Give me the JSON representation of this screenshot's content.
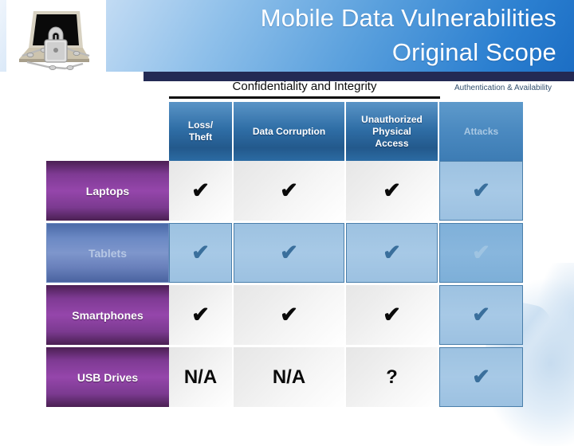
{
  "slide": {
    "title_line1": "Mobile Data Vulnerabilities",
    "title_line2": "Original Scope",
    "title": "Mobile Data Vulnerabilities\nOriginal Scope",
    "logo_icon": "laptop-padlock-chain-image",
    "accent_banner": "#2b7fd0",
    "navy_bar": "#232a54",
    "row_label_purple": "#9546ab",
    "selected_row_blue": "#7e96cc"
  },
  "captions": {
    "confidentiality": "Confidentiality and Integrity",
    "authentication": "Authentication & Availability"
  },
  "table": {
    "columns": [
      {
        "label": "Loss/\nTheft",
        "group": "confidentiality",
        "dim": false
      },
      {
        "label": "Data Corruption",
        "group": "confidentiality",
        "dim": false
      },
      {
        "label": "Unauthorized\nPhysical\nAccess",
        "group": "confidentiality",
        "dim": false
      },
      {
        "label": "Attacks",
        "group": "authentication",
        "dim": true
      }
    ],
    "rows": [
      {
        "label": "Laptops",
        "selected": false,
        "cells": [
          {
            "value": "✔",
            "style": "plain"
          },
          {
            "value": "✔",
            "style": "plain"
          },
          {
            "value": "✔",
            "style": "plain"
          },
          {
            "value": "✔",
            "style": "blue"
          }
        ]
      },
      {
        "label": "Tablets",
        "selected": true,
        "cells": [
          {
            "value": "✔",
            "style": "blue"
          },
          {
            "value": "✔",
            "style": "blue"
          },
          {
            "value": "✔",
            "style": "blue"
          },
          {
            "value": "✔",
            "style": "blue2"
          }
        ]
      },
      {
        "label": "Smartphones",
        "selected": false,
        "cells": [
          {
            "value": "✔",
            "style": "plain"
          },
          {
            "value": "✔",
            "style": "plain"
          },
          {
            "value": "✔",
            "style": "plain"
          },
          {
            "value": "✔",
            "style": "blue"
          }
        ]
      },
      {
        "label": "USB Drives",
        "selected": false,
        "cells": [
          {
            "value": "N/A",
            "style": "plain"
          },
          {
            "value": "N/A",
            "style": "plain"
          },
          {
            "value": "?",
            "style": "plain"
          },
          {
            "value": "✔",
            "style": "blue"
          }
        ]
      }
    ]
  }
}
